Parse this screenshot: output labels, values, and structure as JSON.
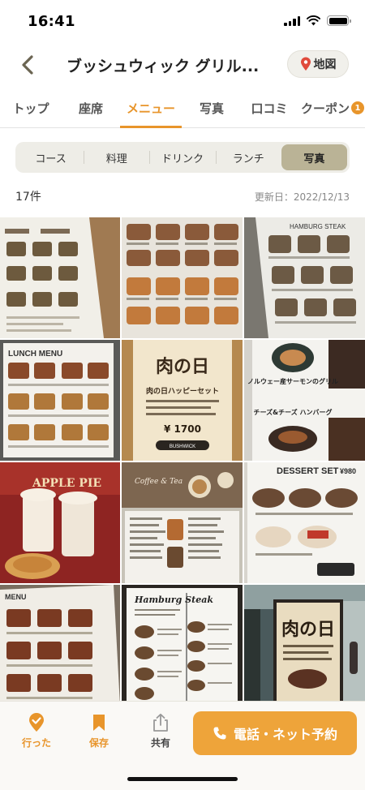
{
  "status": {
    "time": "16:41"
  },
  "header": {
    "title": "ブッシュウィック グリル...",
    "map_label": "地図"
  },
  "tabs": [
    {
      "label": "トップ"
    },
    {
      "label": "座席"
    },
    {
      "label": "メニュー"
    },
    {
      "label": "写真"
    },
    {
      "label": "口コミ"
    },
    {
      "label": "クーポン",
      "badge": "1"
    }
  ],
  "active_tab": "メニュー",
  "segments": [
    "コース",
    "料理",
    "ドリンク",
    "ランチ",
    "写真"
  ],
  "active_segment": "写真",
  "photo_count": "17件",
  "updated": "更新日：2022/12/13",
  "photos": [
    {
      "icon": "menu-photo"
    },
    {
      "icon": "menu-photo"
    },
    {
      "icon": "menu-photo",
      "caption": "HAMBURG STEAK"
    },
    {
      "icon": "menu-photo",
      "caption": "LUNCH MENU"
    },
    {
      "icon": "poster-photo",
      "caption": "肉の日",
      "subcaption": "肉の日ハッピーセット",
      "price": "¥ 1700",
      "brand": "BUSHWICK"
    },
    {
      "icon": "menu-photo",
      "caption": "ノルウェー産サーモンのグリル",
      "subcaption": "チーズ&チーズ ハンバーグ"
    },
    {
      "icon": "drink-photo",
      "caption": "APPLE PIE"
    },
    {
      "icon": "menu-photo",
      "caption": "Coffee & Tea"
    },
    {
      "icon": "menu-photo",
      "caption": "DESSERT SET",
      "price": "¥980"
    },
    {
      "icon": "menu-photo",
      "caption": "MENU"
    },
    {
      "icon": "menu-photo",
      "caption": "Hamburg Steak"
    },
    {
      "icon": "poster-photo",
      "caption": "肉の日"
    }
  ],
  "bottom": {
    "went_label": "行った",
    "save_label": "保存",
    "share_label": "共有",
    "reserve_label": "電話・ネット予約"
  },
  "colors": {
    "accent": "#e8952b",
    "button": "#eea43a",
    "segment_active": "#bab396"
  }
}
